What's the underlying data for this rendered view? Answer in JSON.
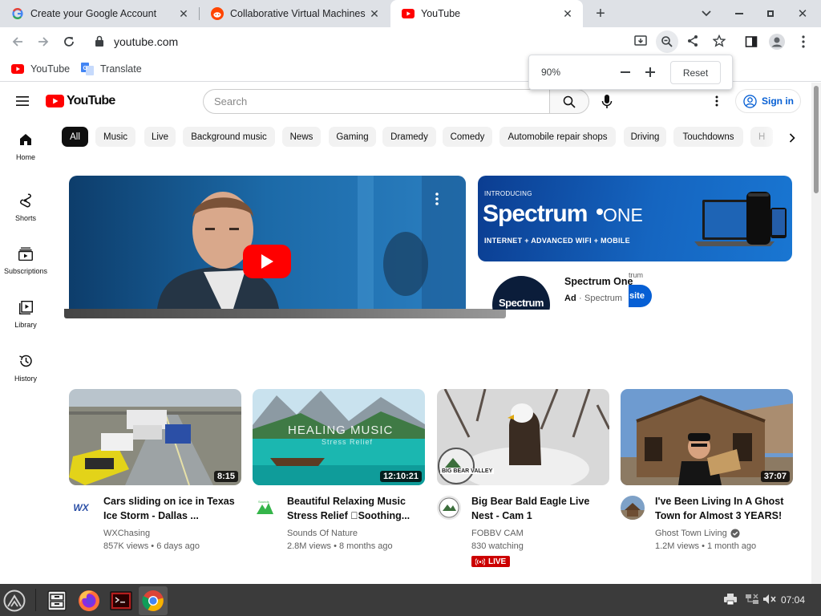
{
  "browser": {
    "tabs": [
      {
        "title": "Create your Google Account",
        "favicon": "google-g-icon",
        "active": false
      },
      {
        "title": "Collaborative Virtual Machines!",
        "favicon": "reddit-icon",
        "active": false
      },
      {
        "title": "YouTube",
        "favicon": "youtube-icon",
        "active": true
      }
    ],
    "url": "youtube.com",
    "bookmarks": [
      {
        "label": "YouTube",
        "icon": "youtube-icon"
      },
      {
        "label": "Translate",
        "icon": "translate-icon"
      }
    ],
    "zoom": {
      "level": "90%",
      "reset_label": "Reset"
    }
  },
  "youtube": {
    "logo_text": "YouTube",
    "search_placeholder": "Search",
    "signin_label": "Sign in",
    "sidebar": [
      {
        "label": "Home",
        "icon": "home-icon"
      },
      {
        "label": "Shorts",
        "icon": "shorts-icon"
      },
      {
        "label": "Subscriptions",
        "icon": "subscriptions-icon"
      },
      {
        "label": "Library",
        "icon": "library-icon"
      },
      {
        "label": "History",
        "icon": "history-icon"
      }
    ],
    "chips": [
      "All",
      "Music",
      "Live",
      "Background music",
      "News",
      "Gaming",
      "Dramedy",
      "Comedy",
      "Automobile repair shops",
      "Driving",
      "Touchdowns",
      "H"
    ],
    "ad": {
      "banner_intro": "INTRODUCING",
      "banner_brand": "Spectrum",
      "banner_brand_suffix": "ONE",
      "banner_tagline": "INTERNET + ADVANCED WIFI + MOBILE",
      "title": "Spectrum One",
      "ad_label": "Ad",
      "advertiser": "Spectrum",
      "overlay_small": "trum",
      "overlay_button": "site",
      "avatar_text": "Spectrum"
    },
    "videos": [
      {
        "title": "Cars sliding on ice in Texas Ice Storm - Dallas ...",
        "channel": "WXChasing",
        "meta": "857K views • 6 days ago",
        "duration": "8:15",
        "verified": false,
        "live": false
      },
      {
        "title": "Beautiful Relaxing Music Stress Relief ⃞Soothing...",
        "channel": "Sounds Of Nature",
        "meta": "2.8M views • 8 months ago",
        "duration": "12:10:21",
        "thumb_text": "HEALING MUSIC",
        "thumb_sub": "Stress Relief",
        "verified": false,
        "live": false
      },
      {
        "title": "Big Bear Bald Eagle Live Nest - Cam 1",
        "channel": "FOBBV CAM",
        "meta": "830 watching",
        "duration": "",
        "thumb_badge": "BIG BEAR VALLEY",
        "verified": false,
        "live": true,
        "live_label": "LIVE"
      },
      {
        "title": "I've Been Living In A Ghost Town for Almost 3 YEARS!",
        "channel": "Ghost Town Living",
        "meta": "1.2M views • 1 month ago",
        "duration": "37:07",
        "verified": true,
        "live": false
      }
    ]
  },
  "taskbar": {
    "clock": "07:04"
  },
  "colors": {
    "youtube_red": "#ff0000",
    "link_blue": "#065fd4",
    "chip_bg": "#f2f2f2",
    "tabstrip": "#dee1e6",
    "taskbar": "#3b3b3b"
  }
}
